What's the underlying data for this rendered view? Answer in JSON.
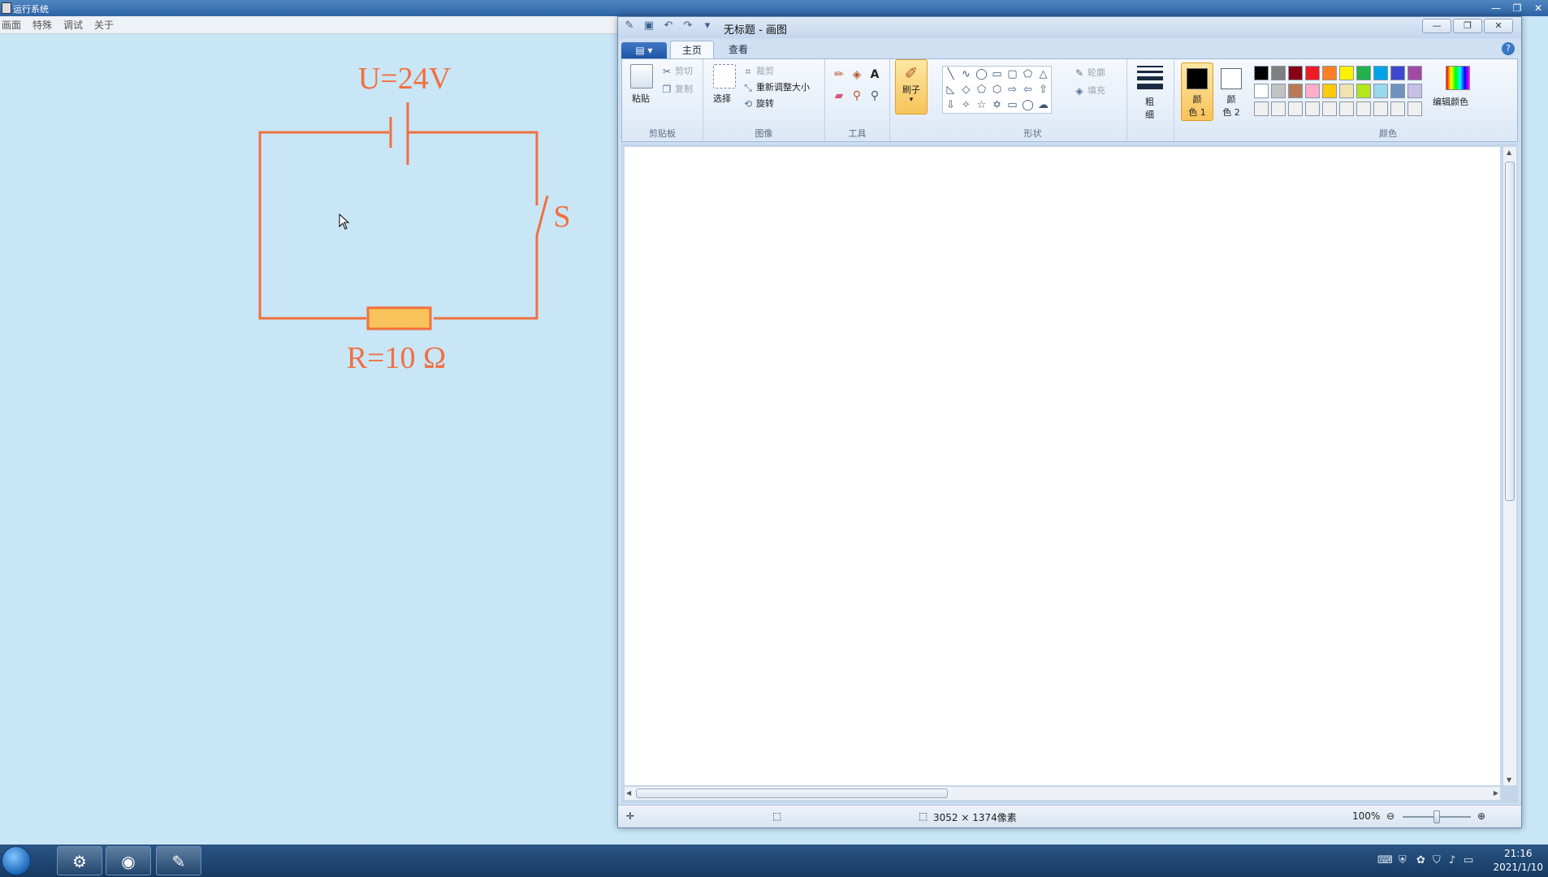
{
  "host": {
    "title": "运行系统",
    "menu": [
      "画面",
      "特殊",
      "调试",
      "关于"
    ],
    "window_controls": [
      "—",
      "❐",
      "✕"
    ]
  },
  "circuit": {
    "voltage_label": "U=24V",
    "resistance_label": "R=10 Ω",
    "switch_label": "S",
    "wire_color": "#f0703f",
    "resistor_fill": "#f8c35a"
  },
  "paint": {
    "title": "无标题 - 画图",
    "window_controls": [
      "—",
      "❐",
      "✕"
    ],
    "file_button": "▤ ▾",
    "tabs": [
      "主页",
      "查看"
    ],
    "help": "?",
    "clipboard": {
      "paste": "粘贴",
      "cut": "剪切",
      "copy": "复制",
      "label": "剪贴板"
    },
    "image": {
      "select": "选择",
      "crop": "裁剪",
      "resize": "重新调整大小",
      "rotate": "旋转",
      "label": "图像"
    },
    "tools": {
      "label": "工具"
    },
    "brushes": {
      "label": "刷子"
    },
    "shapes": {
      "outline": "轮廓",
      "fill": "填充",
      "label": "形状"
    },
    "size": {
      "label1": "粗",
      "label2": "细"
    },
    "color1": {
      "label1": "颜",
      "label2": "色 1"
    },
    "color2": {
      "label1": "颜",
      "label2": "色 2"
    },
    "colors": {
      "label": "颜色",
      "edit": "编辑颜色",
      "palette_row1": [
        "#000000",
        "#7f7f7f",
        "#880015",
        "#ed1c24",
        "#ff7f27",
        "#fff200",
        "#22b14c",
        "#00a2e8",
        "#3f48cc",
        "#a349a4"
      ],
      "palette_row2": [
        "#ffffff",
        "#c3c3c3",
        "#b97a57",
        "#ffaec9",
        "#ffc90e",
        "#efe4b0",
        "#b5e61d",
        "#99d9ea",
        "#7092be",
        "#c8bfe7"
      ],
      "palette_row3": [
        "#f0f0f0",
        "#f0f0f0",
        "#f0f0f0",
        "#f0f0f0",
        "#f0f0f0",
        "#f0f0f0",
        "#f0f0f0",
        "#f0f0f0",
        "#f0f0f0",
        "#f0f0f0"
      ]
    },
    "status": {
      "dimensions": "3052 × 1374像素",
      "zoom": "100%",
      "zoom_level": 1.0
    }
  },
  "taskbar": {
    "time": "21:16",
    "date": "2021/1/10"
  }
}
